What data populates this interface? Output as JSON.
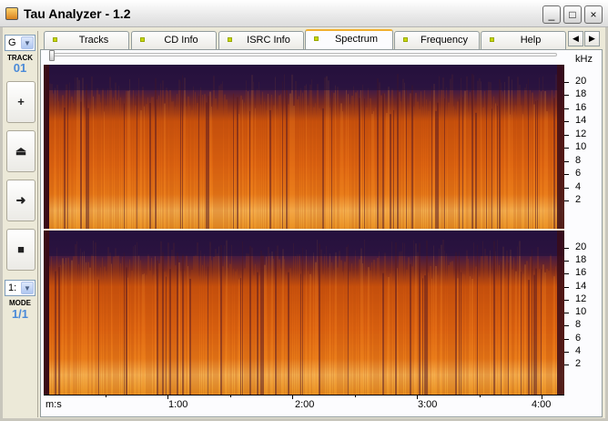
{
  "window": {
    "title": "Tau Analyzer - 1.2",
    "minimize": "_",
    "maximize": "□",
    "close": "×"
  },
  "left_panel": {
    "drive_select": "G",
    "track_label": "TRACK",
    "track_number": "01",
    "buttons": [
      {
        "name": "plus-button",
        "icon": "plus-icon",
        "glyph": "+"
      },
      {
        "name": "eject-button",
        "icon": "eject-icon",
        "glyph": "⏏"
      },
      {
        "name": "play-button",
        "icon": "play-icon",
        "glyph": "➜"
      },
      {
        "name": "stop-button",
        "icon": "stop-icon",
        "glyph": "■"
      }
    ],
    "mode_select": "1:",
    "mode_label": "MODE",
    "mode_value": "1/1"
  },
  "tabs": [
    {
      "label": "Tracks",
      "active": false
    },
    {
      "label": "CD Info",
      "active": false
    },
    {
      "label": "ISRC Info",
      "active": false
    },
    {
      "label": "Spectrum",
      "active": true
    },
    {
      "label": "Frequency",
      "active": false
    },
    {
      "label": "Help",
      "active": false
    }
  ],
  "tab_scroll": {
    "left": "◀",
    "right": "▶"
  },
  "spectrum": {
    "unit_label": "kHz",
    "y_ticks": [
      "20",
      "18",
      "16",
      "14",
      "12",
      "10",
      "8",
      "6",
      "4",
      "2"
    ],
    "x_axis_label": "m:s",
    "x_ticks": [
      "1:00",
      "2:00",
      "3:00",
      "4:00"
    ],
    "colors": {
      "low": "#f7c060",
      "mid": "#e06008",
      "high": "#c84408",
      "empty": "#2a1040"
    }
  }
}
